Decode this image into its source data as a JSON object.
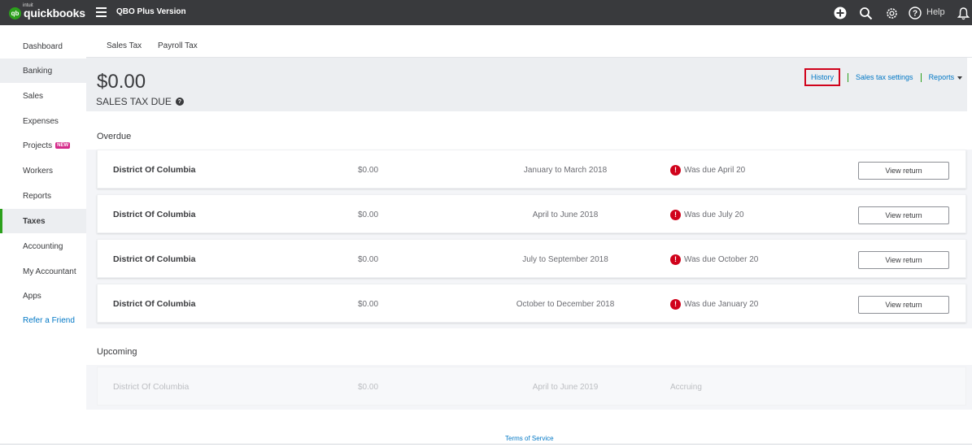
{
  "topbar": {
    "logo_small": "intuit",
    "logo_badge": "qb",
    "logo_text": "quickbooks",
    "company": "QBO Plus Version",
    "help_label": "Help",
    "icons": [
      "plus-icon",
      "search-icon",
      "gear-icon",
      "help-icon",
      "bell-icon"
    ]
  },
  "sidebar": {
    "items": [
      {
        "label": "Dashboard"
      },
      {
        "label": "Banking"
      },
      {
        "label": "Sales"
      },
      {
        "label": "Expenses"
      },
      {
        "label": "Projects",
        "badge": "NEW"
      },
      {
        "label": "Workers"
      },
      {
        "label": "Reports"
      },
      {
        "label": "Taxes"
      },
      {
        "label": "Accounting"
      },
      {
        "label": "My Accountant"
      },
      {
        "label": "Apps"
      },
      {
        "label": "Refer a Friend"
      }
    ]
  },
  "tabs": [
    "Sales Tax",
    "Payroll Tax"
  ],
  "summary": {
    "amount": "$0.00",
    "label": "SALES TAX DUE"
  },
  "header_links": {
    "history": "History",
    "settings": "Sales tax settings",
    "reports": "Reports"
  },
  "overdue": {
    "title": "Overdue",
    "rows": [
      {
        "name": "District Of Columbia",
        "amount": "$0.00",
        "period": "January to March 2018",
        "status": "Was due April 20",
        "action": "View return"
      },
      {
        "name": "District Of Columbia",
        "amount": "$0.00",
        "period": "April to June 2018",
        "status": "Was due July 20",
        "action": "View return"
      },
      {
        "name": "District Of Columbia",
        "amount": "$0.00",
        "period": "July to September 2018",
        "status": "Was due October 20",
        "action": "View return"
      },
      {
        "name": "District Of Columbia",
        "amount": "$0.00",
        "period": "October to December 2018",
        "status": "Was due January 20",
        "action": "View return"
      }
    ]
  },
  "upcoming": {
    "title": "Upcoming",
    "rows": [
      {
        "name": "District Of Columbia",
        "amount": "$0.00",
        "period": "April to June 2019",
        "status": "Accruing"
      }
    ]
  },
  "footer": {
    "terms": "Terms of Service"
  },
  "colors": {
    "topbar": "#393a3d",
    "brand_green": "#2ca01c",
    "link_blue": "#0077c5",
    "alert_red": "#d0021b",
    "highlight_box": "#d0021b"
  }
}
